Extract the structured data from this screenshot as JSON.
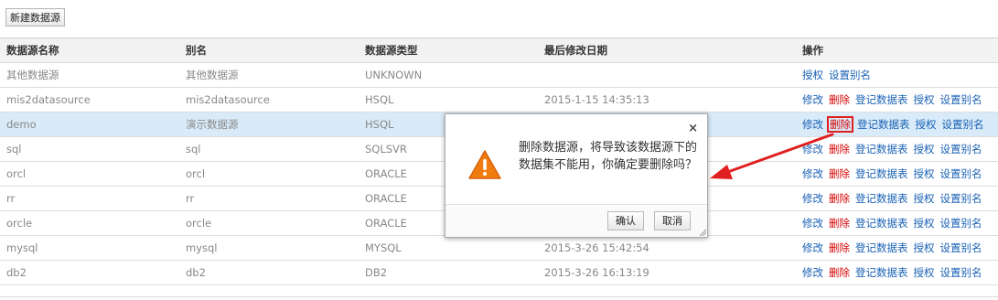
{
  "toolbar": {
    "new_datasource": "新建数据源"
  },
  "table": {
    "headers": {
      "name": "数据源名称",
      "alias": "别名",
      "type": "数据源类型",
      "modified": "最后修改日期",
      "ops": "操作"
    },
    "ops_labels": {
      "edit": "修改",
      "delete": "删除",
      "register": "登记数据表",
      "authorize": "授权",
      "set_alias": "设置别名"
    },
    "rows": [
      {
        "name": "其他数据源",
        "alias": "其他数据源",
        "type": "UNKNOWN",
        "modified": ""
      },
      {
        "name": "mis2datasource",
        "alias": "mis2datasource",
        "type": "HSQL",
        "modified": "2015-1-15 14:35:13"
      },
      {
        "name": "demo",
        "alias": "演示数据源",
        "type": "HSQL",
        "modified": ""
      },
      {
        "name": "sql",
        "alias": "sql",
        "type": "SQLSVR",
        "modified": ""
      },
      {
        "name": "orcl",
        "alias": "orcl",
        "type": "ORACLE",
        "modified": ""
      },
      {
        "name": "rr",
        "alias": "rr",
        "type": "ORACLE",
        "modified": ""
      },
      {
        "name": "orcle",
        "alias": "orcle",
        "type": "ORACLE",
        "modified": ""
      },
      {
        "name": "mysql",
        "alias": "mysql",
        "type": "MYSQL",
        "modified": "2015-3-26 15:42:54"
      },
      {
        "name": "db2",
        "alias": "db2",
        "type": "DB2",
        "modified": "2015-3-26 16:13:19"
      }
    ]
  },
  "dialog": {
    "close": "×",
    "message": "删除数据源，将导致该数据源下的数据集不能用，你确定要删除吗？",
    "confirm": "确认",
    "cancel": "取消"
  },
  "colors": {
    "link": "#1a62b5",
    "delete": "#d40000",
    "selected_row": "#d9ebf9",
    "arrow": "#e02020",
    "warning": "#f07c10"
  }
}
